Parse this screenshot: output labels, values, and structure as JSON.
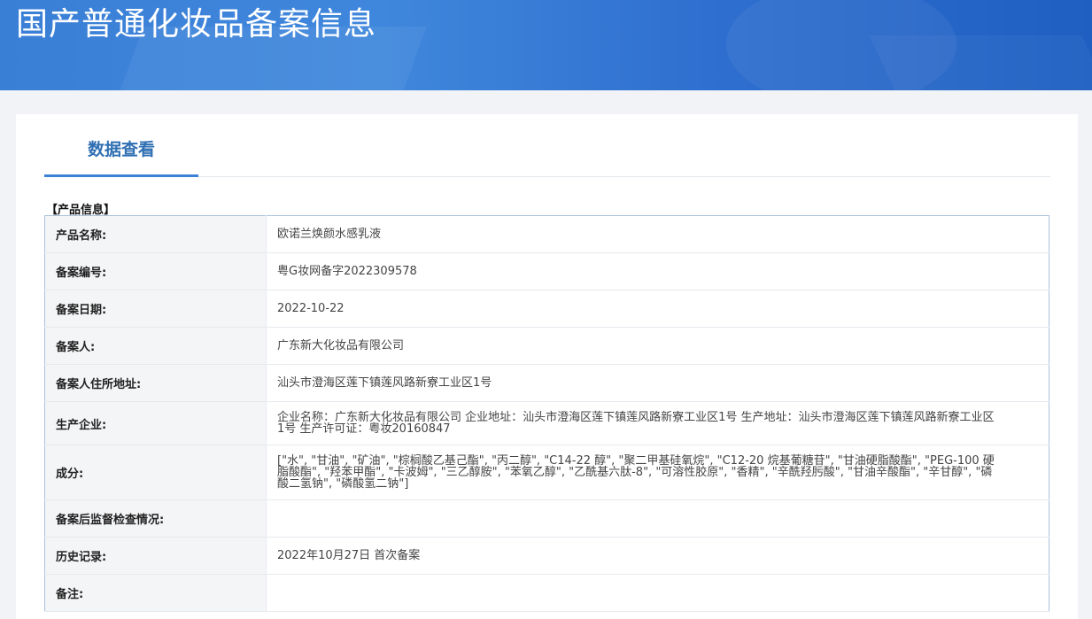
{
  "page": {
    "title": "国产普通化妆品备案信息"
  },
  "tabs": [
    {
      "label": "数据查看"
    }
  ],
  "section": {
    "title": "【产品信息】"
  },
  "rows": [
    {
      "label": "产品名称:",
      "value": "欧诺兰焕颜水感乳液"
    },
    {
      "label": "备案编号:",
      "value": "粤G妆网备字2022309578"
    },
    {
      "label": "备案日期:",
      "value": "2022-10-22"
    },
    {
      "label": "备案人:",
      "value": "广东新大化妆品有限公司"
    },
    {
      "label": "备案人住所地址:",
      "value": "汕头市澄海区莲下镇莲风路新寮工业区1号"
    },
    {
      "label": "生产企业:",
      "value": "企业名称：广东新大化妆品有限公司 企业地址：汕头市澄海区莲下镇莲风路新寮工业区1号 生产地址：汕头市澄海区莲下镇莲风路新寮工业区1号 生产许可证：粤妆20160847"
    },
    {
      "label": "成分:",
      "value": "[\"水\", \"甘油\", \"矿油\", \"棕榈酸乙基己酯\", \"丙二醇\", \"C14-22 醇\", \"聚二甲基硅氧烷\", \"C12-20 烷基葡糖苷\", \"甘油硬脂酸酯\", \"PEG-100 硬脂酸酯\", \"羟苯甲酯\", \"卡波姆\", \"三乙醇胺\", \"苯氧乙醇\", \"乙酰基六肽-8\", \"可溶性胶原\", \"香精\", \"辛酰羟肟酸\", \"甘油辛酸酯\", \"辛甘醇\", \"磷酸二氢钠\", \"磷酸氢二钠\"]"
    },
    {
      "label": "备案后监督检查情况:",
      "value": ""
    },
    {
      "label": "历史记录:",
      "value": "2022年10月27日 首次备案"
    },
    {
      "label": "备注:",
      "value": ""
    }
  ]
}
